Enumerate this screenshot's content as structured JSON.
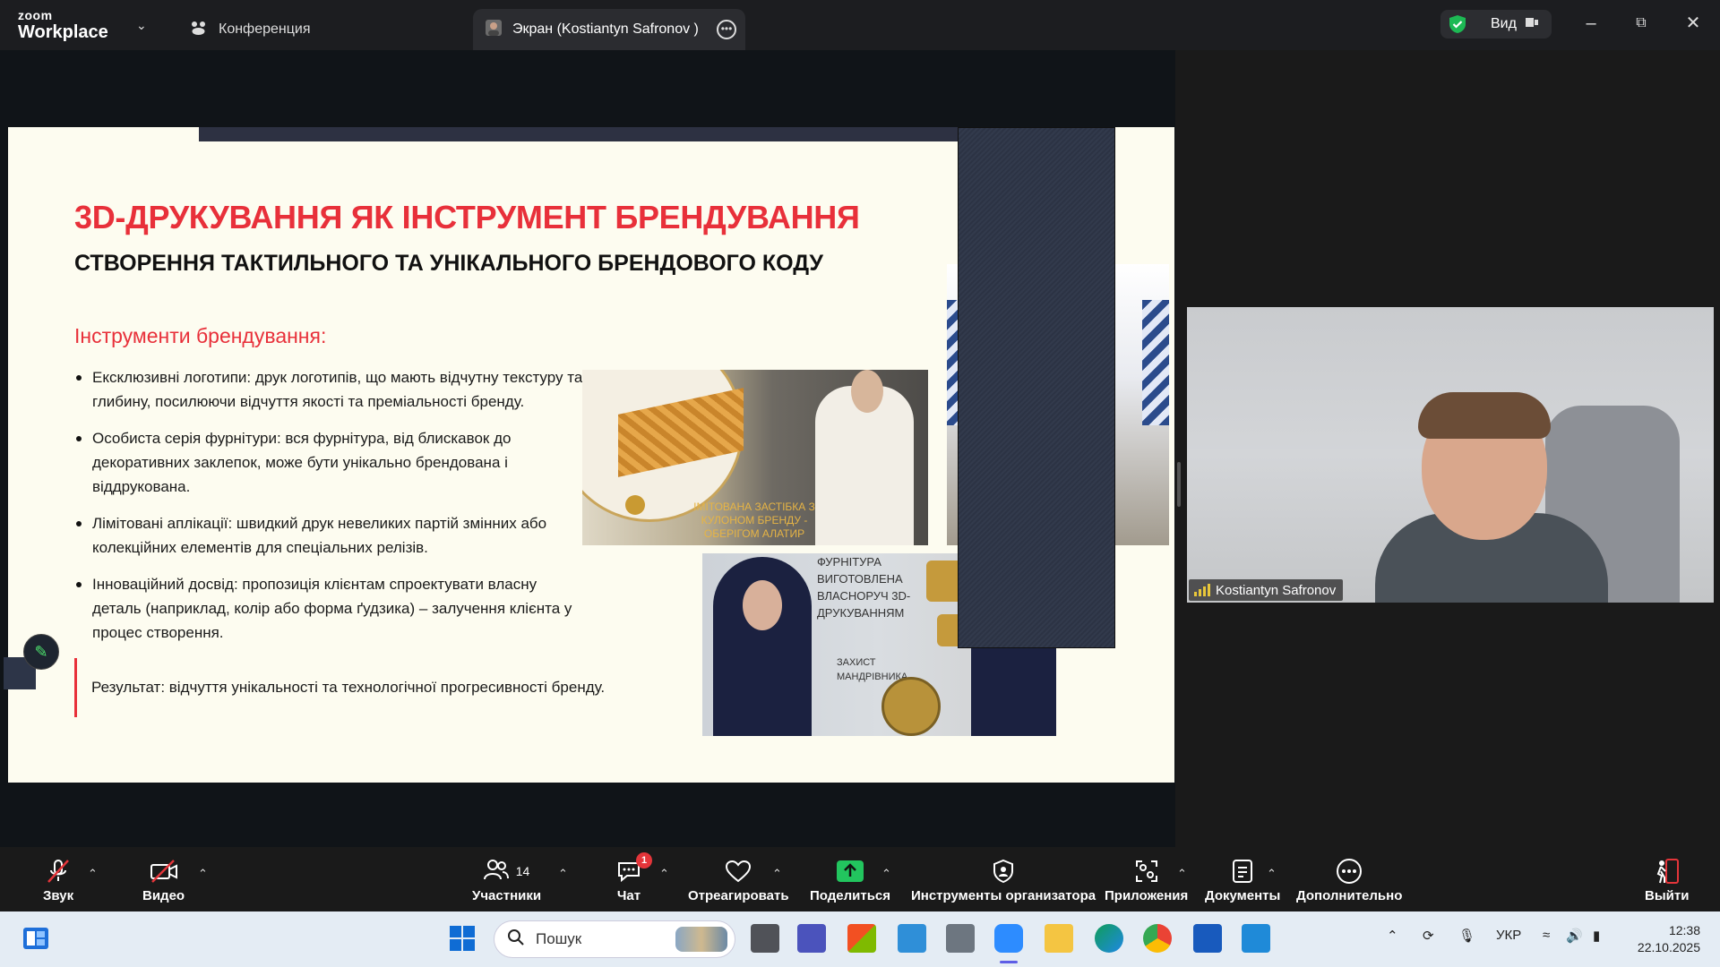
{
  "app": {
    "brand_top": "zoom",
    "brand_bottom": "Workplace"
  },
  "tabs": [
    {
      "label": "Конференция",
      "icon": "people-icon"
    },
    {
      "label": "Экран (Kostiantyn Safronov )",
      "icon": "avatar-icon"
    }
  ],
  "view": {
    "label": "Вид",
    "secure_icon": "shield-check-icon",
    "secure_color": "#1db954"
  },
  "slide": {
    "title": "3D-ДРУКУВАННЯ ЯК ІНСТРУМЕНТ БРЕНДУВАННЯ",
    "subtitle": "СТВОРЕННЯ ТАКТИЛЬНОГО ТА УНІКАЛЬНОГО БРЕНДОВОГО КОДУ",
    "section": "Інструменти брендування:",
    "bullets": [
      "Ексклюзивні логотипи: друк логотипів, що мають відчутну текстуру та глибину, посилюючи відчуття якості та преміальності бренду.",
      "Особиста серія фурнітури: вся фурнітура, від блискавок до декоративних заклепок, може бути унікально брендована і віддрукована.",
      "Лімітовані аплікації: швидкий друк невеликих партій змінних або колекційних елементів для спеціальних релізів.",
      "Інноваційний досвід: пропозиція клієнтам спроектувати власну деталь (наприклад, колір або форма ґудзика) – залучення клієнта у процес створення."
    ],
    "result": "Результат: відчуття унікальності та технологічної прогресивності бренду.",
    "img1_caption": "ІМІТОВАНА ЗАСТІБКА З КУЛОНОМ БРЕНДУ - ОБЕРІГОМ АЛАТИР",
    "img3_caption": "ФУРНІТУРА ВИГОТОВЛЕНА ВЛАСНОРУЧ 3D-ДРУКУВАННЯМ",
    "img3_caption2": "ЗАХИСТ МАНДРІВНИКА",
    "accent": "#e8303a"
  },
  "participant": {
    "name": "Kostiantyn Safronov"
  },
  "toolbar": {
    "audio": "Звук",
    "video": "Видео",
    "participants": "Участники",
    "participants_count": "14",
    "chat": "Чат",
    "chat_badge": "1",
    "react": "Отреагировать",
    "share": "Поделиться",
    "host_tools": "Инструменты организатора",
    "apps": "Приложения",
    "docs": "Документы",
    "more": "Дополнительно",
    "leave": "Выйти",
    "share_color": "#22c55e",
    "leave_color": "#e4353a"
  },
  "taskbar": {
    "search_placeholder": "Пошук",
    "lang": "УКР",
    "time": "12:38",
    "date": "22.10.2025"
  }
}
